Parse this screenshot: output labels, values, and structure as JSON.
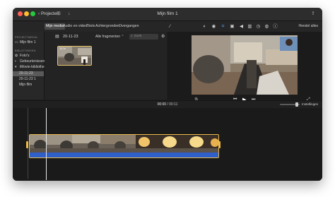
{
  "window": {
    "title": "Mijn film 1"
  },
  "titlebar": {
    "back_label": "Projecten",
    "back_icon": "chevron-left-icon",
    "share_icon": "share-icon"
  },
  "toolbar": {
    "tabs": [
      "Mijn media",
      "Audio en video",
      "Titels",
      "Achtergronden",
      "Overgangen"
    ],
    "active_tab": "Mijn media",
    "adjust_icons": [
      "color-balance-icon",
      "color-correction-icon",
      "crop-icon",
      "stabilization-icon",
      "volume-icon",
      "noise-reduction-icon",
      "speed-icon",
      "filter-icon",
      "info-icon"
    ],
    "reset_label": "Herstel alles"
  },
  "sidebar": {
    "section1": "PROJECTMEDIA",
    "project_item": "Mijn film 1",
    "section2": "BIBLIOTHEKEN",
    "items": [
      {
        "label": "Foto's",
        "icon": "photos-icon"
      },
      {
        "label": "Gebeurtenissen",
        "icon": "events-icon"
      },
      {
        "label": "iMovie-bibliotheek",
        "icon": "library-icon"
      },
      {
        "label": "20-11-23",
        "icon": ""
      },
      {
        "label": "20-11-23 1",
        "icon": ""
      },
      {
        "label": "Mijn film",
        "icon": ""
      }
    ],
    "selected": "20-11-23"
  },
  "browser": {
    "date": "20-11-23",
    "filter": "Alle fragmenten",
    "search_placeholder": "Zoek",
    "clip": {
      "duration": "10,1s"
    }
  },
  "timeline": {
    "current_time": "00:00",
    "separator": "/",
    "total_time": "00:11",
    "settings_label": "Instellingen"
  },
  "colors": {
    "accent": "#e9b949",
    "audio": "#2f5fc9",
    "window_bg": "#1e1e1e"
  }
}
